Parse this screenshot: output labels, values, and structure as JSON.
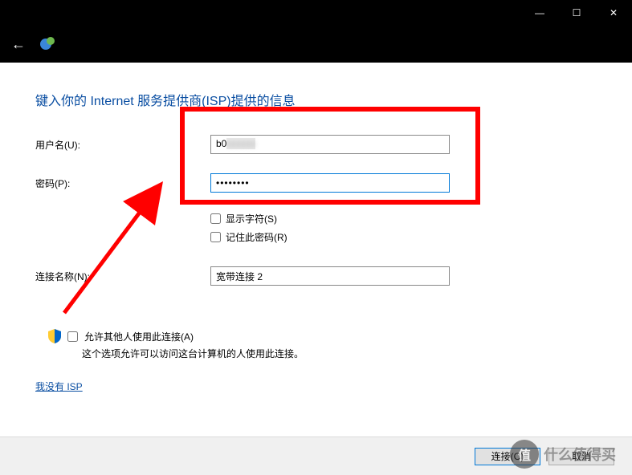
{
  "titlebar": {
    "minimize": "—",
    "maximize": "☐",
    "close": "✕"
  },
  "heading": "键入你的 Internet 服务提供商(ISP)提供的信息",
  "form": {
    "username_label": "用户名(U):",
    "username_value_prefix": "b0",
    "username_value_blurred": "xxxxxx",
    "password_label": "密码(P):",
    "password_value": "••••••••",
    "show_chars_label": "显示字符(S)",
    "remember_label": "记住此密码(R)",
    "conn_name_label": "连接名称(N):",
    "conn_name_value": "宽带连接 2"
  },
  "allow": {
    "checkbox_label": "允许其他人使用此连接(A)",
    "desc": "这个选项允许可以访问这台计算机的人使用此连接。"
  },
  "link": "我没有 ISP",
  "footer": {
    "connect": "连接(C)",
    "cancel": "取消"
  },
  "watermark": {
    "icon": "值",
    "text": "什么值得买"
  }
}
